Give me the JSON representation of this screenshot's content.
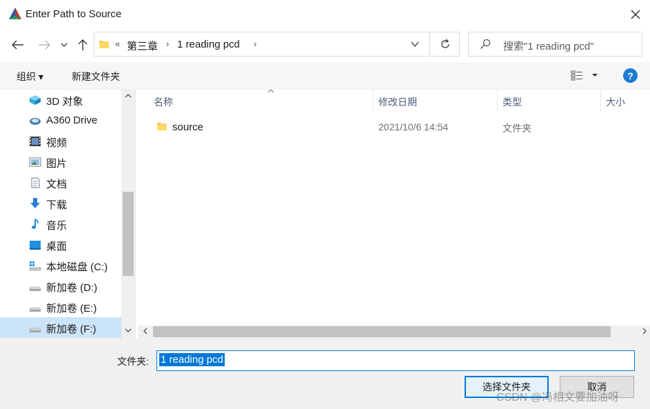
{
  "window": {
    "title": "Enter Path to Source",
    "close_glyph": "✕"
  },
  "nav": {
    "back_glyph": "←",
    "forward_glyph": "→",
    "recent_glyph": "⌄",
    "up_glyph": "↑"
  },
  "address": {
    "overflow_glyph": "«",
    "crumbs": [
      "第三章",
      "1 reading pcd"
    ],
    "separator_glyph": "›"
  },
  "search": {
    "placeholder": "搜索\"1 reading pcd\""
  },
  "toolbar": {
    "organize_label": "组织 ▾",
    "new_folder_label": "新建文件夹",
    "help_label": "?"
  },
  "sidebar": {
    "items": [
      {
        "label": "3D 对象",
        "icon": "3d-objects-icon"
      },
      {
        "label": "A360 Drive",
        "icon": "cloud-drive-icon"
      },
      {
        "label": "视频",
        "icon": "video-icon"
      },
      {
        "label": "图片",
        "icon": "pictures-icon"
      },
      {
        "label": "文档",
        "icon": "documents-icon"
      },
      {
        "label": "下载",
        "icon": "download-icon"
      },
      {
        "label": "音乐",
        "icon": "music-icon"
      },
      {
        "label": "桌面",
        "icon": "desktop-icon"
      },
      {
        "label": "本地磁盘 (C:)",
        "icon": "local-disk-icon"
      },
      {
        "label": "新加卷 (D:)",
        "icon": "drive-icon"
      },
      {
        "label": "新加卷 (E:)",
        "icon": "drive-icon"
      },
      {
        "label": "新加卷 (F:)",
        "icon": "drive-icon",
        "selected": true
      }
    ]
  },
  "columns": {
    "name": "名称",
    "modified": "修改日期",
    "type": "类型",
    "size": "大小"
  },
  "files": [
    {
      "name": "source",
      "modified": "2021/10/6 14:54",
      "type": "文件夹"
    }
  ],
  "filename": {
    "label": "文件夹:",
    "value": "1 reading pcd"
  },
  "buttons": {
    "select_label": "选择文件夹",
    "cancel_label": "取消"
  },
  "watermark": "CSDN @冯相文要加油呀",
  "colors": {
    "accent": "#0078d7",
    "selection": "#cce4f7",
    "folder": "#f4c542"
  }
}
